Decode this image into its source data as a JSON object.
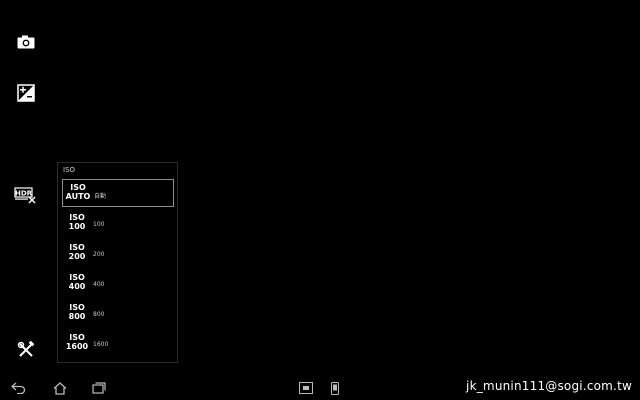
{
  "sidebar": {
    "icons": [
      {
        "name": "camera-icon"
      },
      {
        "name": "exposure-icon"
      },
      {
        "name": "hdr-off-icon"
      },
      {
        "name": "settings-tools-icon"
      }
    ]
  },
  "iso_panel": {
    "title": "ISO",
    "selected_index": 0,
    "options": [
      {
        "line1": "ISO",
        "line2": "AUTO",
        "value": "自動"
      },
      {
        "line1": "ISO",
        "line2": "100",
        "value": "100"
      },
      {
        "line1": "ISO",
        "line2": "200",
        "value": "200"
      },
      {
        "line1": "ISO",
        "line2": "400",
        "value": "400"
      },
      {
        "line1": "ISO",
        "line2": "800",
        "value": "800"
      },
      {
        "line1": "ISO",
        "line2": "1600",
        "value": "1600"
      }
    ]
  },
  "navbar": {
    "icons": [
      "back-icon",
      "home-icon",
      "recent-apps-icon",
      "small-app-icon",
      "phone-icon"
    ]
  },
  "watermark": "jk_munin111@sogi.com.tw"
}
